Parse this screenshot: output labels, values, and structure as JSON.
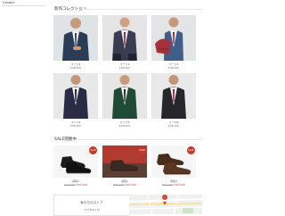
{
  "sidebar": {
    "label": "Contact"
  },
  "new_collection": {
    "title": "新作コレクション",
    "items": [
      {
        "name": "スーツ1",
        "price": "¥38,000"
      },
      {
        "name": "スーツ2",
        "price": "¥38,000"
      },
      {
        "name": "スーツ3",
        "price": "¥38,000"
      },
      {
        "name": "スーツ4",
        "price": "¥38,000"
      },
      {
        "name": "スーツ5",
        "price": "¥38,000"
      },
      {
        "name": "スーツ6",
        "price": "¥38,000"
      }
    ]
  },
  "sale": {
    "title": "SALE開催中",
    "items": [
      {
        "name": "革靴1",
        "old_price": "¥15,000",
        "new_price": "¥10,000",
        "badge": "SALE"
      },
      {
        "name": "革靴2",
        "old_price": "¥15,000",
        "new_price": "¥10,000",
        "badge": "SALE"
      },
      {
        "name": "革靴3",
        "old_price": "¥15,000",
        "new_price": "¥10,000",
        "badge": "SALE"
      }
    ]
  },
  "store": {
    "title": "私たちのストア",
    "address": "123 Main St"
  },
  "colors": {
    "sale_red": "#c0392b",
    "rule": "#e6e6e6"
  }
}
